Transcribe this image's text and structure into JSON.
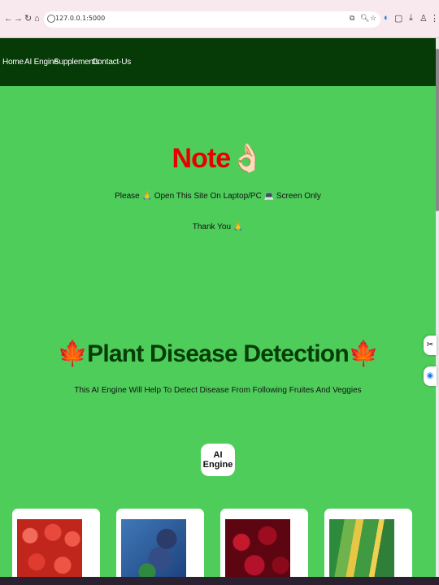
{
  "browser": {
    "url": "127.0.0.1:5000",
    "nav_icons": [
      "back-icon",
      "forward-icon",
      "reload-icon",
      "home-icon"
    ]
  },
  "navbar": {
    "items": [
      "Home",
      "AI Engine",
      "Supplements",
      "Contact-Us"
    ]
  },
  "note": {
    "title": "Note👌🏻",
    "line1": "Please 🙏 Open This Site On Laptop/PC 💻 Screen Only",
    "line2": "Thank You 🙏"
  },
  "detection": {
    "title": "🍁Plant Disease Detection🍁",
    "subtitle": "This AI Engine Will Help To Detect Disease From Following Fruites And Veggies",
    "button_label": "AI Engine"
  },
  "cards": [
    {
      "name": "apple-card",
      "image": "apples"
    },
    {
      "name": "blueberry-card",
      "image": "blueberries"
    },
    {
      "name": "cherry-card",
      "image": "cherries"
    },
    {
      "name": "corn-card",
      "image": "corn"
    }
  ],
  "colors": {
    "page_bg": "#4fcd5b",
    "navbar_bg": "#063a06",
    "note_title": "#e60000",
    "heading": "#073d07"
  }
}
